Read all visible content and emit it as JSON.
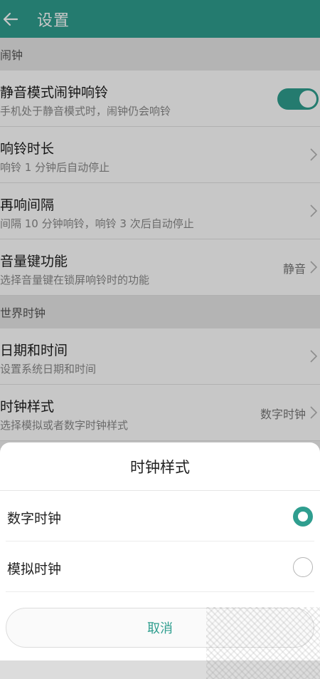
{
  "header": {
    "title": "设置"
  },
  "sections": [
    {
      "label": "闹钟",
      "rows": [
        {
          "title": "静音模式闹钟响铃",
          "subtitle": "手机处于静音模式时，闹钟仍会响铃",
          "toggle": true
        },
        {
          "title": "响铃时长",
          "subtitle": "响铃 1 分钟后自动停止"
        },
        {
          "title": "再响间隔",
          "subtitle": "间隔 10 分钟响铃，响铃 3 次后自动停止"
        },
        {
          "title": "音量键功能",
          "subtitle": "选择音量键在锁屏响铃时的功能",
          "value": "静音"
        }
      ]
    },
    {
      "label": "世界时钟",
      "rows": [
        {
          "title": "日期和时间",
          "subtitle": "设置系统日期和时间"
        },
        {
          "title": "时钟样式",
          "subtitle": "选择模拟或者数字时钟样式",
          "value": "数字时钟"
        }
      ]
    }
  ],
  "dialog": {
    "title": "时钟样式",
    "options": [
      {
        "label": "数字时钟",
        "selected": true
      },
      {
        "label": "模拟时钟",
        "selected": false
      }
    ],
    "cancel_label": "取消"
  },
  "colors": {
    "accent": "#2f9e8f",
    "header_bg": "#2f9e8f"
  },
  "icons": {
    "back": "arrow-left-icon",
    "chevron": "chevron-right-icon"
  }
}
